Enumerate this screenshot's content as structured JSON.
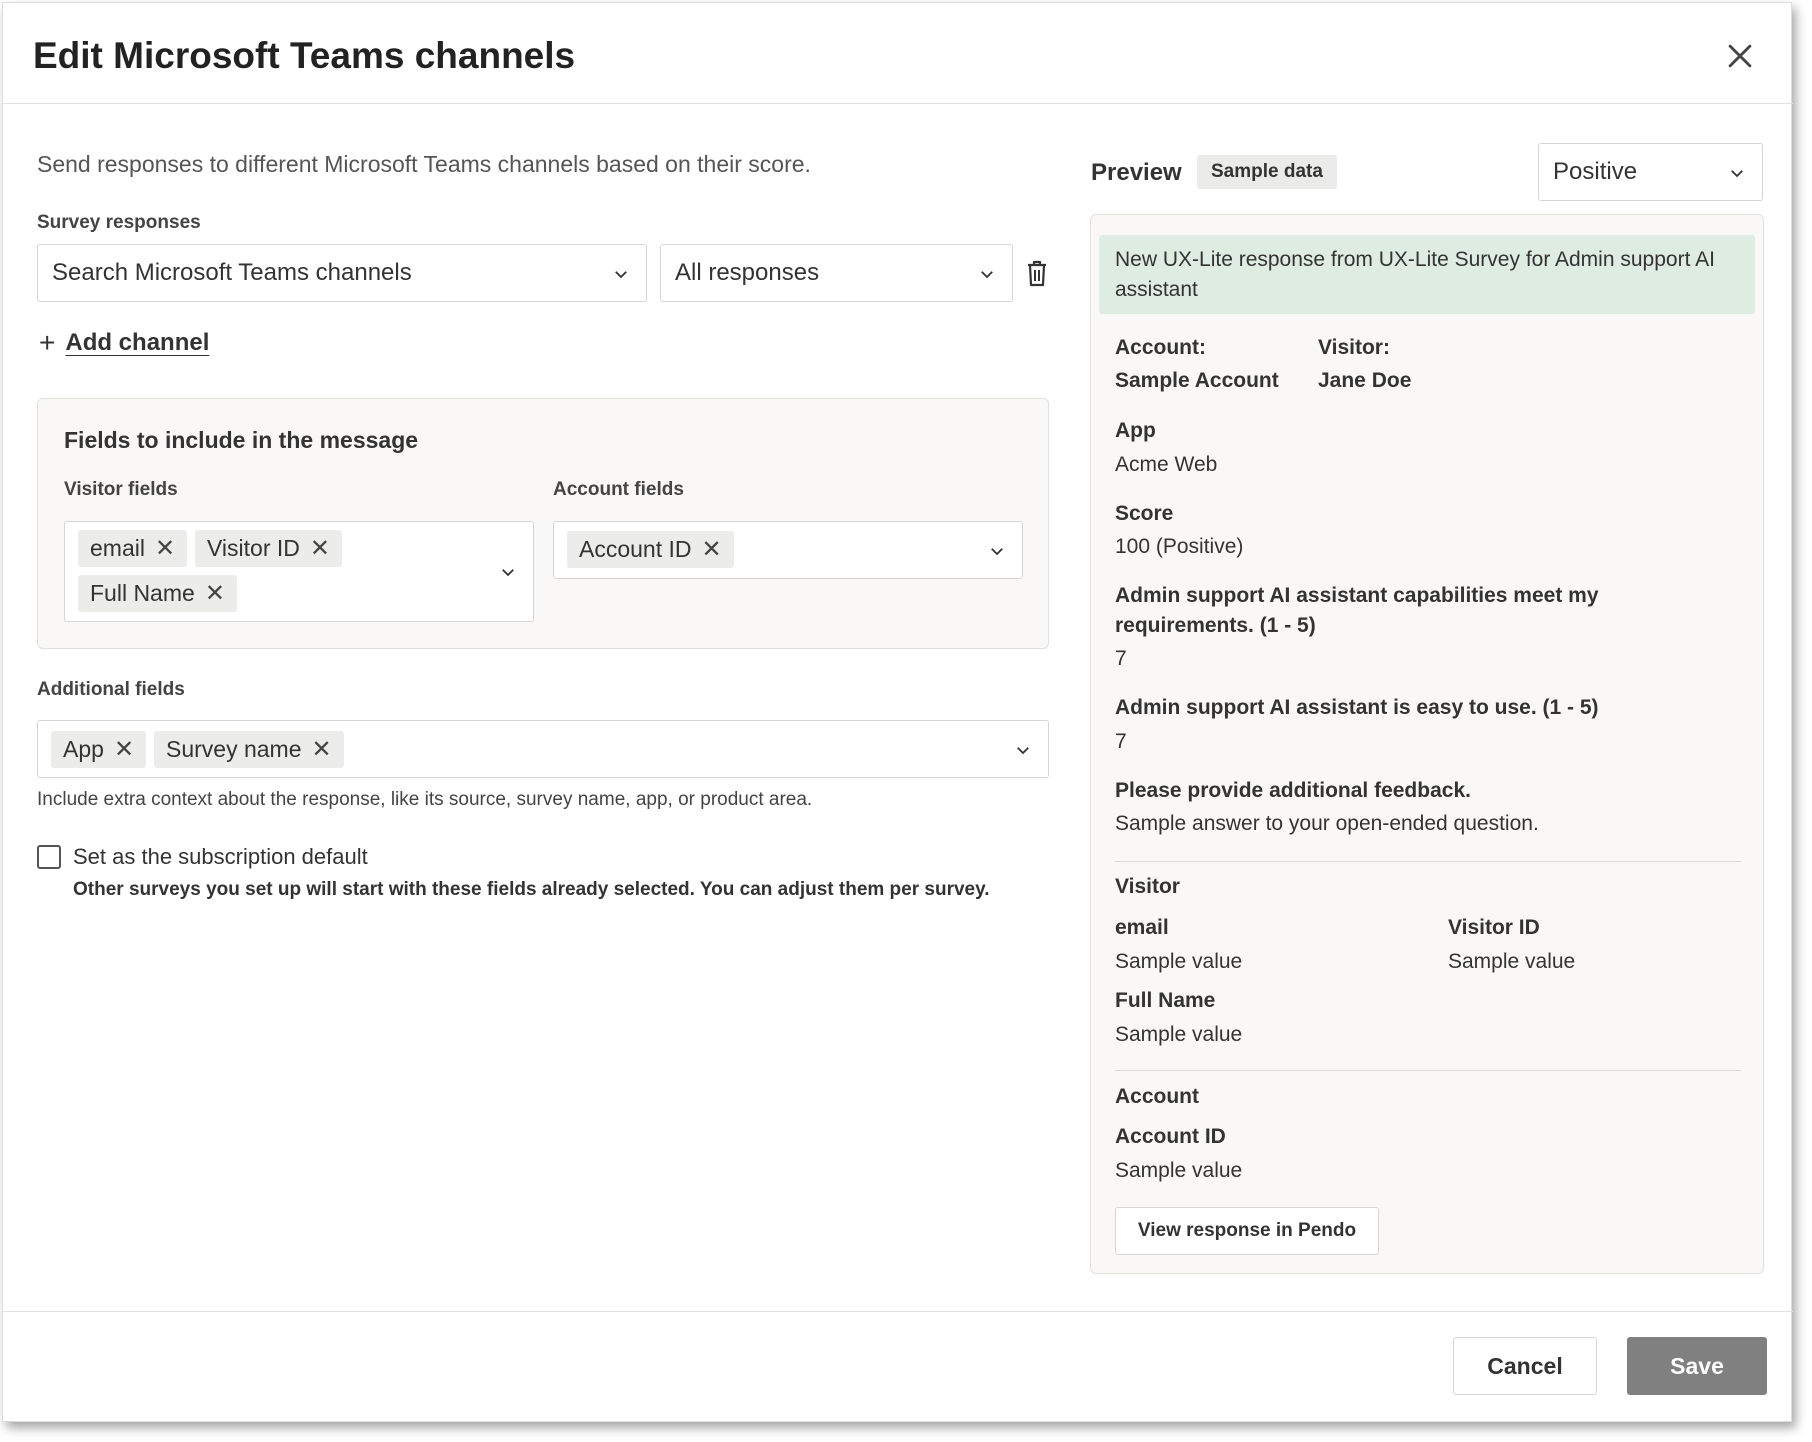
{
  "dialog": {
    "title": "Edit Microsoft Teams channels"
  },
  "form": {
    "intro": "Send responses to different Microsoft Teams channels based on their score.",
    "survey_responses_label": "Survey responses",
    "channel_select_value": "Search Microsoft Teams channels",
    "responses_select_value": "All responses",
    "add_channel_label": "Add channel",
    "fields_box": {
      "title": "Fields to include in the message",
      "visitor_label": "Visitor fields",
      "visitor_chips": [
        "email",
        "Visitor ID",
        "Full Name"
      ],
      "account_label": "Account fields",
      "account_chips": [
        "Account ID"
      ]
    },
    "additional_label": "Additional fields",
    "additional_chips": [
      "App",
      "Survey name"
    ],
    "additional_help": "Include extra context about the response, like its source, survey name, app, or product area.",
    "default_checkbox_label": "Set as the subscription default",
    "default_checkbox_checked": false,
    "default_checkbox_help": "Other surveys you set up will start with these fields already selected. You can adjust them per survey."
  },
  "preview": {
    "title": "Preview",
    "badge": "Sample data",
    "sentiment_select": "Positive",
    "banner": "New UX-Lite response from UX-Lite Survey for Admin support AI assistant",
    "account_label": "Account:",
    "account_value": "Sample Account",
    "visitor_label": "Visitor:",
    "visitor_value": "Jane Doe",
    "app_label": "App",
    "app_value": "Acme Web",
    "score_label": "Score",
    "score_value": "100 (Positive)",
    "q1_line1": "Admin support AI assistant capabilities meet my",
    "q1_line2": "requirements. (1 - 5)",
    "q1_value": "7",
    "q2_label": "Admin support AI assistant is easy to use. (1 - 5)",
    "q2_value": "7",
    "q3_label": "Please provide additional feedback.",
    "q3_value": "Sample answer to your open-ended question.",
    "visitor_section": "Visitor",
    "v_email_label": "email",
    "v_email_value": "Sample value",
    "v_id_label": "Visitor ID",
    "v_id_value": "Sample value",
    "v_name_label": "Full Name",
    "v_name_value": "Sample value",
    "account_section": "Account",
    "a_id_label": "Account ID",
    "a_id_value": "Sample value",
    "view_button": "View response in Pendo"
  },
  "footer": {
    "cancel_label": "Cancel",
    "save_label": "Save"
  },
  "colors": {
    "banner_bg": "#dfece1",
    "save_disabled_bg": "#808080",
    "panel_bg": "#f9f8f7"
  },
  "icons": [
    "close-icon",
    "chevron-down-icon",
    "trash-icon",
    "plus-icon",
    "remove-chip-icon"
  ]
}
